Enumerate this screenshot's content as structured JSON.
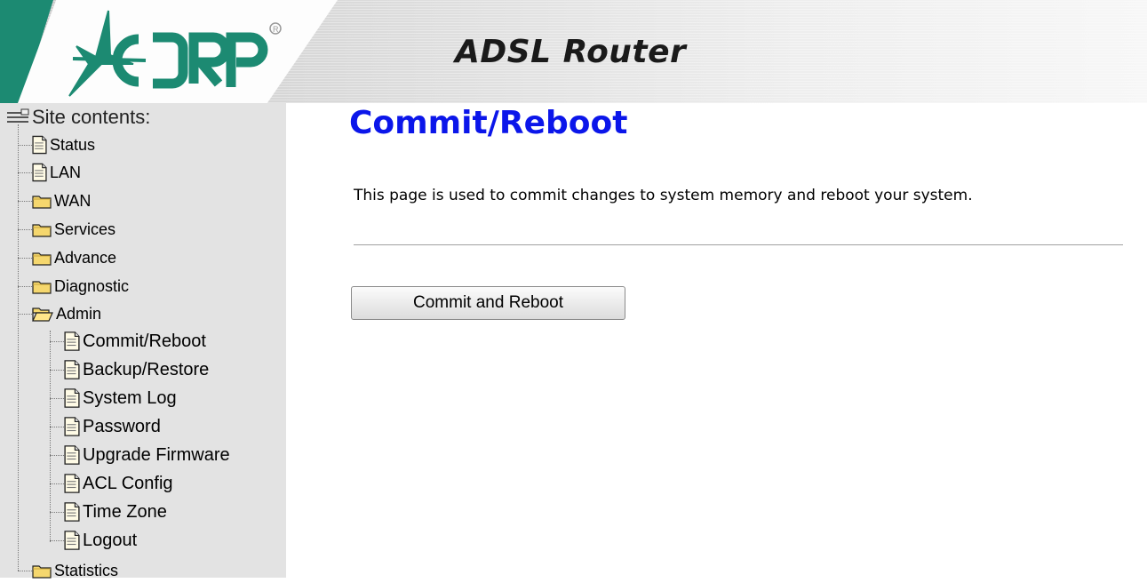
{
  "header": {
    "logo_text": "ACORP",
    "title": "ADSL Router"
  },
  "sidebar": {
    "root_label": "Site contents:",
    "items": [
      {
        "label": "Status",
        "icon": "page-icon"
      },
      {
        "label": "LAN",
        "icon": "page-icon"
      },
      {
        "label": "WAN",
        "icon": "folder-icon"
      },
      {
        "label": "Services",
        "icon": "folder-icon"
      },
      {
        "label": "Advance",
        "icon": "folder-icon"
      },
      {
        "label": "Diagnostic",
        "icon": "folder-icon"
      },
      {
        "label": "Admin",
        "icon": "folder-open-icon"
      },
      {
        "label": "Statistics",
        "icon": "folder-icon"
      }
    ],
    "admin_children": [
      {
        "label": "Commit/Reboot",
        "icon": "page-icon"
      },
      {
        "label": "Backup/Restore",
        "icon": "page-icon"
      },
      {
        "label": "System Log",
        "icon": "page-icon"
      },
      {
        "label": "Password",
        "icon": "page-icon"
      },
      {
        "label": "Upgrade Firmware",
        "icon": "page-icon"
      },
      {
        "label": "ACL Config",
        "icon": "page-icon"
      },
      {
        "label": "Time Zone",
        "icon": "page-icon"
      },
      {
        "label": "Logout",
        "icon": "page-icon"
      }
    ]
  },
  "main": {
    "title": "Commit/Reboot",
    "description": "This page is used to commit changes to system memory and reboot your system.",
    "button_label": "Commit and Reboot"
  },
  "colors": {
    "title_blue": "#0b16ea",
    "brand_green": "#1c8a72",
    "sidebar_bg": "#e3e3e3"
  }
}
